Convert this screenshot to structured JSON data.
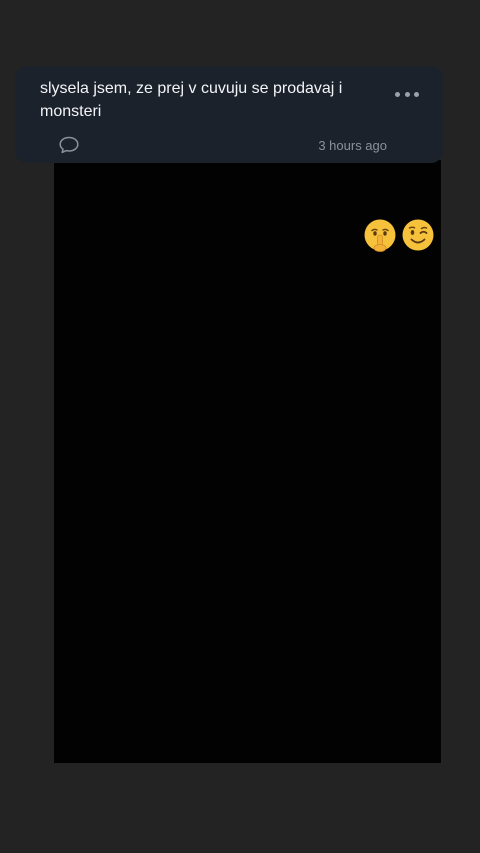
{
  "post": {
    "text": "slysela jsem, ze prej v cuvuju se prodavaj i monsteri",
    "timestamp": "3 hours ago",
    "icons": {
      "more": "more-dots-icon",
      "comment": "comment-bubble-icon"
    }
  },
  "stickers": [
    "shushing-face-emoji",
    "winking-face-emoji"
  ],
  "colors": {
    "background": "#232323",
    "card": "#1c222c",
    "photo": "#020203",
    "text": "#f2f4f7",
    "muted": "#8a919b"
  }
}
